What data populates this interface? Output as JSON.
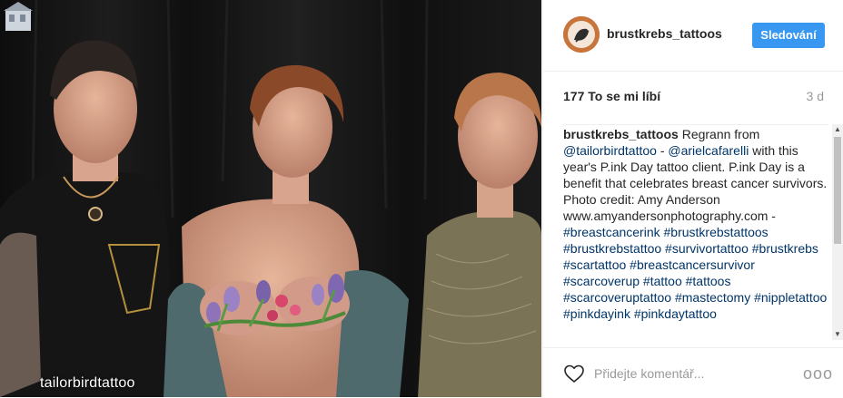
{
  "photo": {
    "watermark": "tailorbirdtattoo"
  },
  "header": {
    "username": "brustkrebs_tattoos",
    "follow_label": "Sledování"
  },
  "stats": {
    "likes": "177 To se mi líbí",
    "time_ago": "3 d"
  },
  "caption": {
    "username": "brustkrebs_tattoos",
    "text_1": "Regrann from",
    "mention_1": "@tailorbirdtattoo",
    "text_2": " - ",
    "mention_2": "@arielcafarelli",
    "text_3": " with this year's P.ink Day tattoo client. P.ink Day is a benefit that celebrates breast cancer survivors. Photo credit: Amy Anderson www.amyandersonphotography.com - ",
    "hashtags": "#breastcancerink #brustkrebstattoos #brustkrebstattoo #survivortattoo #brustkrebs #scartattoo #breastcancersurvivor #scarcoverup #tattoo #tattoos #scarcoveruptattoo #mastectomy #nippletattoo #pinkdayink #pinkdaytattoo"
  },
  "footer": {
    "comment_placeholder": "Přidejte komentář...",
    "more_label": "ooo"
  },
  "colors": {
    "accent": "#3897f0",
    "link": "#003569",
    "muted": "#999999"
  },
  "icons": {
    "heart": "heart-icon",
    "more": "more-options-icon"
  }
}
